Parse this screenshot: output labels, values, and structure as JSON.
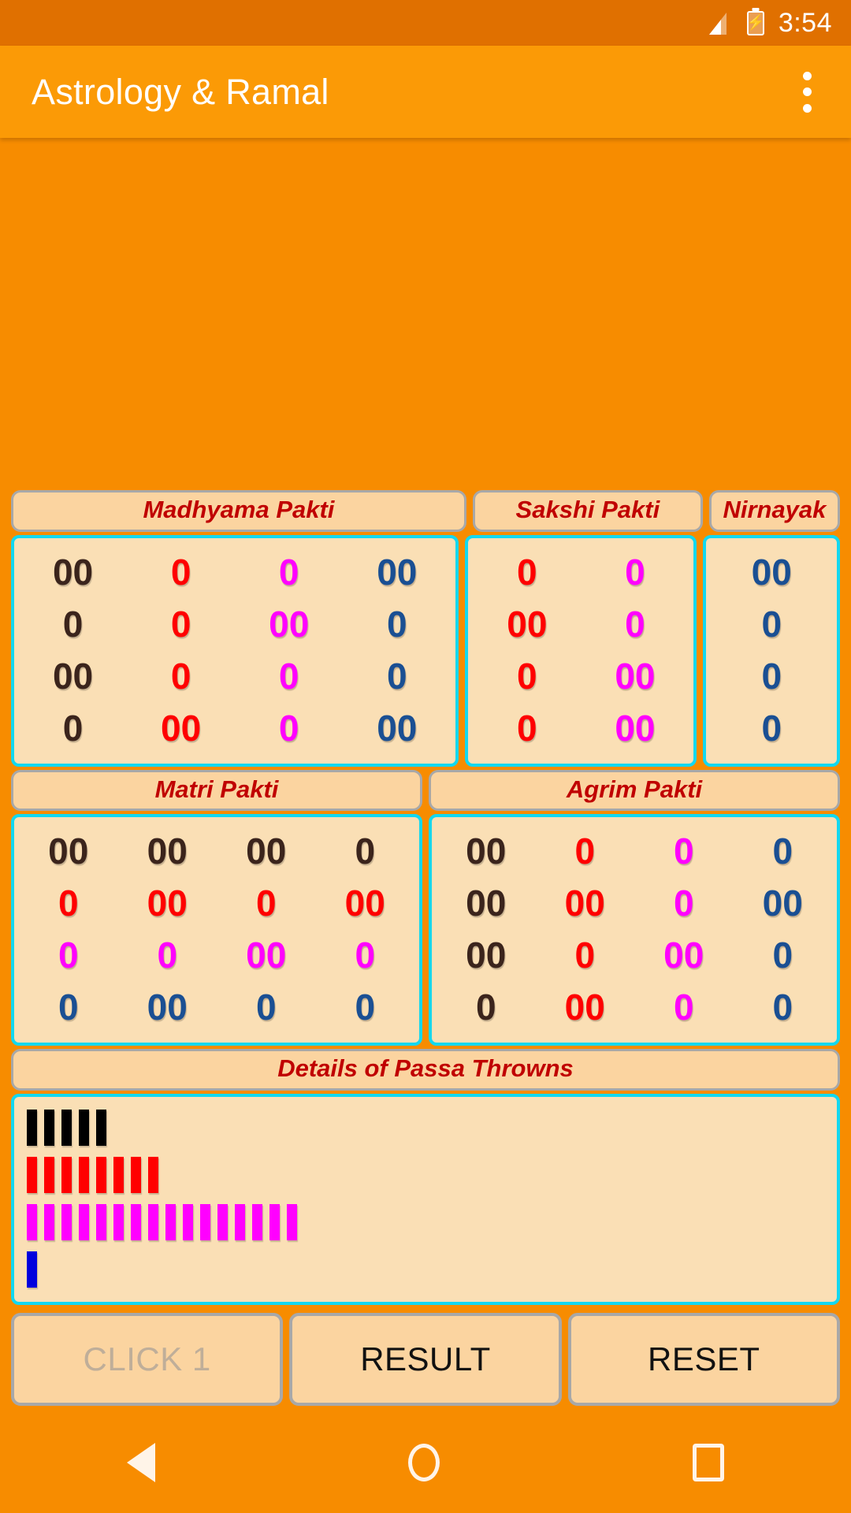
{
  "statusbar": {
    "time": "3:54",
    "signal_icon": "signal-bars-icon",
    "battery_icon": "battery-charging-icon",
    "battery_glyph": "⚡"
  },
  "actionbar": {
    "title": "Astrology & Ramal",
    "overflow_icon": "overflow-menu-icon"
  },
  "colors": {
    "accent_orange": "#F78C00",
    "appbar_orange": "#FB9A06",
    "statusbar_orange": "#E07000",
    "panel_fill": "#FADFB5",
    "panel_border_cyan": "#13D8F0",
    "header_fill": "#FBD4A0",
    "header_border_grey": "#A8A8A8",
    "title_red": "#C00000",
    "digit_black": "#3B241C",
    "digit_red": "#FF0000",
    "digit_magenta": "#FF00FF",
    "digit_blue": "#1A4F93"
  },
  "tables": {
    "row1_headers": [
      {
        "label": "Madhyama Pakti",
        "width": 4
      },
      {
        "label": "Sakshi Pakti",
        "width": 2
      },
      {
        "label": "Nirnayak",
        "width": 1
      }
    ],
    "row2_headers": [
      {
        "label": "Matri Pakti",
        "width": 4
      },
      {
        "label": "Agrim Pakti",
        "width": 4
      }
    ],
    "madhyama_pakti": [
      [
        {
          "v": "00",
          "c": "black"
        },
        {
          "v": "0",
          "c": "red"
        },
        {
          "v": "0",
          "c": "magenta"
        },
        {
          "v": "00",
          "c": "blue"
        }
      ],
      [
        {
          "v": "0",
          "c": "black"
        },
        {
          "v": "0",
          "c": "red"
        },
        {
          "v": "00",
          "c": "magenta"
        },
        {
          "v": "0",
          "c": "blue"
        }
      ],
      [
        {
          "v": "00",
          "c": "black"
        },
        {
          "v": "0",
          "c": "red"
        },
        {
          "v": "0",
          "c": "magenta"
        },
        {
          "v": "0",
          "c": "blue"
        }
      ],
      [
        {
          "v": "0",
          "c": "black"
        },
        {
          "v": "00",
          "c": "red"
        },
        {
          "v": "0",
          "c": "magenta"
        },
        {
          "v": "00",
          "c": "blue"
        }
      ]
    ],
    "sakshi_pakti": [
      [
        {
          "v": "0",
          "c": "red"
        },
        {
          "v": "0",
          "c": "magenta"
        }
      ],
      [
        {
          "v": "00",
          "c": "red"
        },
        {
          "v": "0",
          "c": "magenta"
        }
      ],
      [
        {
          "v": "0",
          "c": "red"
        },
        {
          "v": "00",
          "c": "magenta"
        }
      ],
      [
        {
          "v": "0",
          "c": "red"
        },
        {
          "v": "00",
          "c": "magenta"
        }
      ]
    ],
    "nirnayak": [
      [
        {
          "v": "00",
          "c": "blue"
        }
      ],
      [
        {
          "v": "0",
          "c": "blue"
        }
      ],
      [
        {
          "v": "0",
          "c": "blue"
        }
      ],
      [
        {
          "v": "0",
          "c": "blue"
        }
      ]
    ],
    "matri_pakti": [
      [
        {
          "v": "00",
          "c": "black"
        },
        {
          "v": "00",
          "c": "black"
        },
        {
          "v": "00",
          "c": "black"
        },
        {
          "v": "0",
          "c": "black"
        }
      ],
      [
        {
          "v": "0",
          "c": "red"
        },
        {
          "v": "00",
          "c": "red"
        },
        {
          "v": "0",
          "c": "red"
        },
        {
          "v": "00",
          "c": "red"
        }
      ],
      [
        {
          "v": "0",
          "c": "magenta"
        },
        {
          "v": "0",
          "c": "magenta"
        },
        {
          "v": "00",
          "c": "magenta"
        },
        {
          "v": "0",
          "c": "magenta"
        }
      ],
      [
        {
          "v": "0",
          "c": "blue"
        },
        {
          "v": "00",
          "c": "blue"
        },
        {
          "v": "0",
          "c": "blue"
        },
        {
          "v": "0",
          "c": "blue"
        }
      ]
    ],
    "agrim_pakti": [
      [
        {
          "v": "00",
          "c": "black"
        },
        {
          "v": "0",
          "c": "red"
        },
        {
          "v": "0",
          "c": "magenta"
        },
        {
          "v": "0",
          "c": "blue"
        }
      ],
      [
        {
          "v": "00",
          "c": "black"
        },
        {
          "v": "00",
          "c": "red"
        },
        {
          "v": "0",
          "c": "magenta"
        },
        {
          "v": "00",
          "c": "blue"
        }
      ],
      [
        {
          "v": "00",
          "c": "black"
        },
        {
          "v": "0",
          "c": "red"
        },
        {
          "v": "00",
          "c": "magenta"
        },
        {
          "v": "0",
          "c": "blue"
        }
      ],
      [
        {
          "v": "0",
          "c": "black"
        },
        {
          "v": "00",
          "c": "red"
        },
        {
          "v": "0",
          "c": "magenta"
        },
        {
          "v": "0",
          "c": "blue"
        }
      ]
    ]
  },
  "passa": {
    "header": "Details of Passa Throwns",
    "tally_rows": [
      {
        "color": "#000000",
        "count": 5
      },
      {
        "color": "#FF0000",
        "count": 8
      },
      {
        "color": "#FF00FF",
        "count": 16
      },
      {
        "color": "#0000DD",
        "count": 1
      }
    ]
  },
  "buttons": [
    {
      "label": "CLICK 1",
      "disabled": true,
      "name": "click-button"
    },
    {
      "label": "RESULT",
      "disabled": false,
      "name": "result-button"
    },
    {
      "label": "RESET",
      "disabled": false,
      "name": "reset-button"
    }
  ],
  "navbar": {
    "back_icon": "back-triangle-icon",
    "home_icon": "home-circle-icon",
    "recent_icon": "recents-square-icon"
  }
}
